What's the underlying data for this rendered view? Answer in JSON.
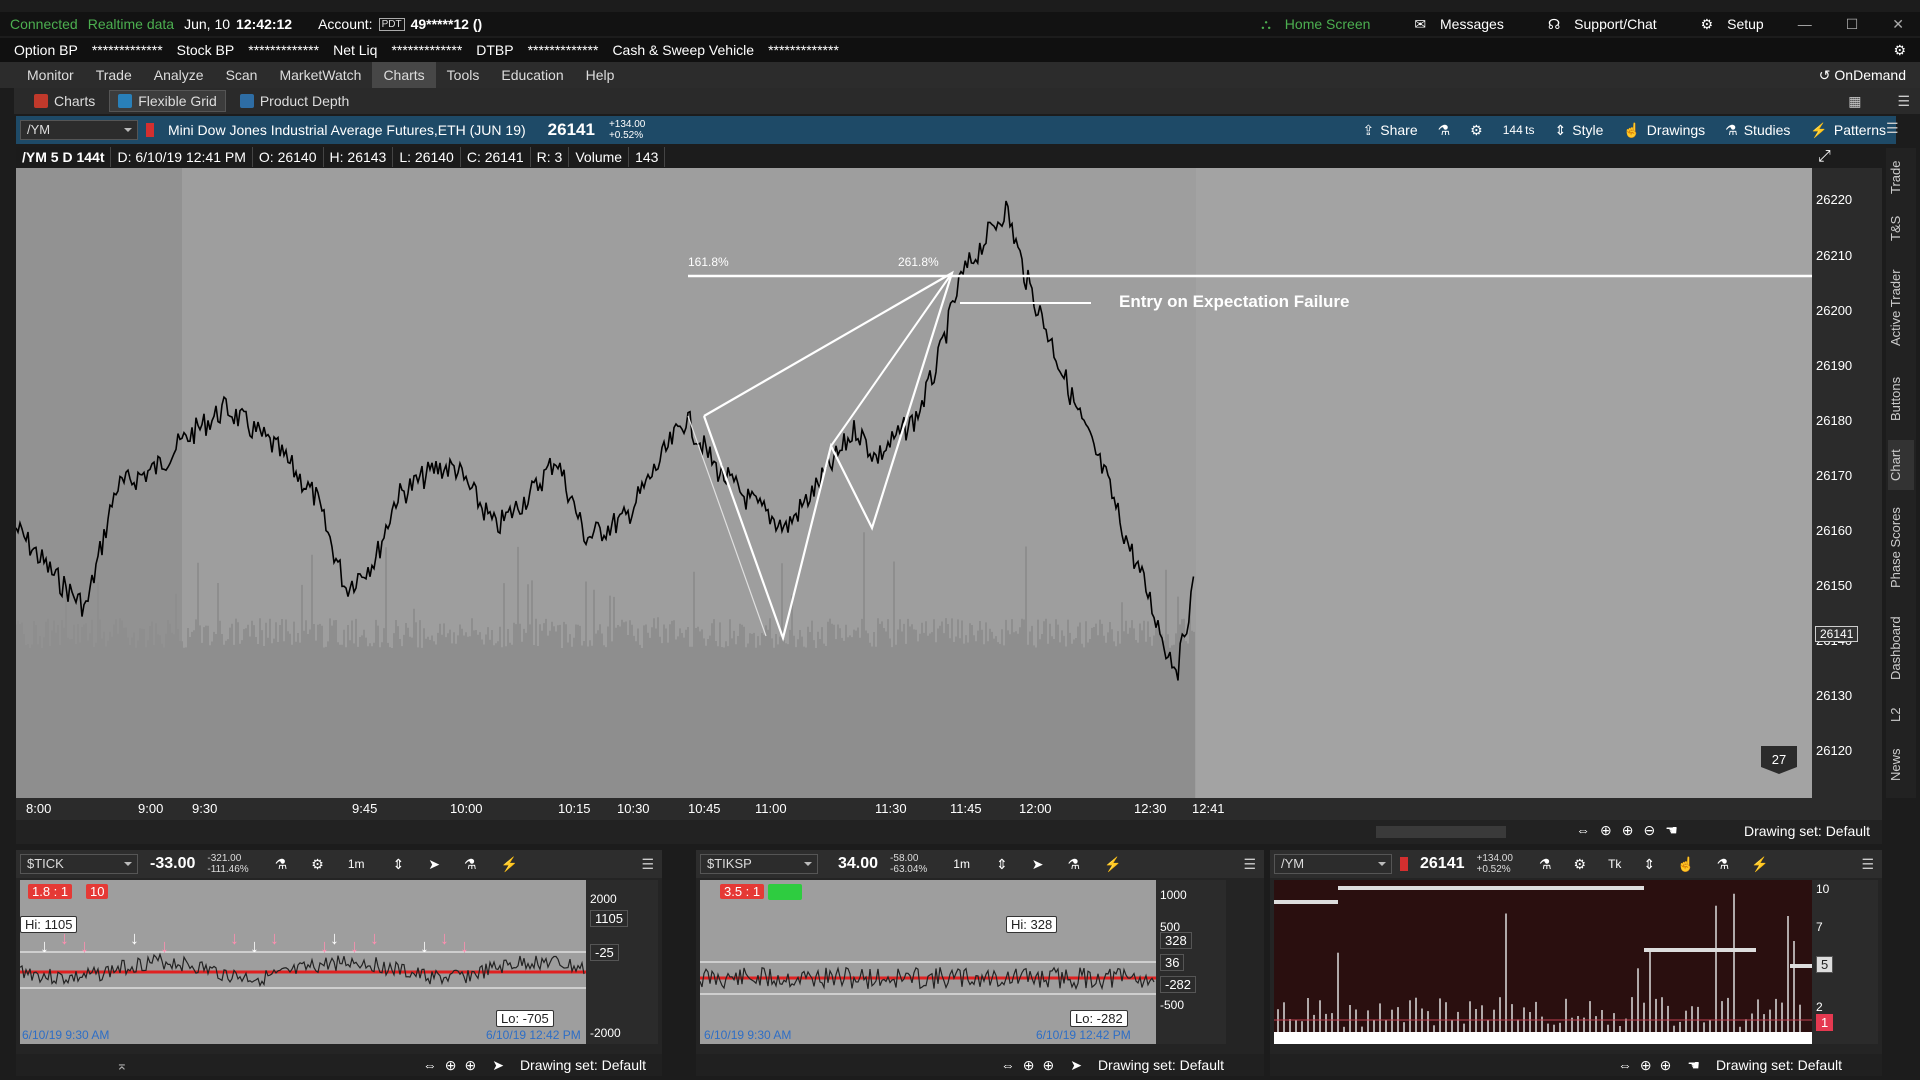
{
  "status": {
    "connected": "Connected",
    "realtime": "Realtime data",
    "date": "Jun, 10",
    "time": "12:42:12",
    "account_label": "Account:",
    "account_tag": "PDT",
    "account_value": "49*****12 ()",
    "home": "Home Screen",
    "messages": "Messages",
    "support": "Support/Chat",
    "setup": "Setup"
  },
  "balances": [
    {
      "label": "Option BP",
      "value": "*************"
    },
    {
      "label": "Stock BP",
      "value": "*************"
    },
    {
      "label": "Net Liq",
      "value": "*************"
    },
    {
      "label": "DTBP",
      "value": "*************"
    },
    {
      "label": "Cash & Sweep Vehicle",
      "value": "*************"
    }
  ],
  "nav": {
    "items": [
      "Monitor",
      "Trade",
      "Analyze",
      "Scan",
      "MarketWatch",
      "Charts",
      "Tools",
      "Education",
      "Help"
    ],
    "active": "Charts",
    "ondemand": "OnDemand"
  },
  "subnav": [
    "Charts",
    "Flexible Grid",
    "Product Depth"
  ],
  "chart_header": {
    "symbol": "/YM",
    "description": "Mini Dow Jones Industrial Average Futures,ETH (JUN 19)",
    "price": "26141",
    "change": "+134.00",
    "change_pct": "+0.52%",
    "share": "Share",
    "ticks": "144 ts",
    "style": "Style",
    "drawings": "Drawings",
    "studies": "Studies",
    "patterns": "Patterns"
  },
  "ohlc": {
    "sym": "/YM 5 D 144t",
    "date": "D: 6/10/19 12:41 PM",
    "open": "O: 26140",
    "high": "H: 26143",
    "low": "L: 26140",
    "close": "C: 26141",
    "range": "R: 3",
    "volume_label": "Volume",
    "volume": "143"
  },
  "main_chart": {
    "fib1": "161.8%",
    "fib2": "261.8%",
    "annotation": "Entry on Expectation Failure",
    "price_labels": [
      "26220",
      "26210",
      "26200",
      "26190",
      "26180",
      "26170",
      "26160",
      "26150",
      "26140",
      "26130",
      "26120"
    ],
    "current_price_tag": "26141",
    "time_labels": [
      "8:00",
      "9:00",
      "9:30",
      "9:45",
      "10:00",
      "10:15",
      "10:30",
      "10:45",
      "11:00",
      "11:30",
      "11:45",
      "12:00",
      "12:30",
      "12:41"
    ],
    "badge": "27",
    "drawing_set": "Drawing set: Default"
  },
  "side_tabs": [
    "Trade",
    "T&S",
    "Active Trader",
    "Buttons",
    "Chart",
    "Phase Scores",
    "Dashboard",
    "L2",
    "News"
  ],
  "panels": [
    {
      "symbol": "$TICK",
      "value": "-33.00",
      "chg1": "-321.00",
      "chg2": "-111.46%",
      "interval": "1m",
      "ratio": "1.8 : 1",
      "ratio_b": "10",
      "hi": "Hi: 1105",
      "lo": "Lo: -705",
      "scale": [
        "2000",
        "1105",
        "-25",
        "-2000"
      ],
      "start": "6/10/19 9:30 AM",
      "end": "6/10/19 12:42 PM",
      "drawing_set": "Drawing set: Default"
    },
    {
      "symbol": "$TIKSP",
      "value": "34.00",
      "chg1": "-58.00",
      "chg2": "-63.04%",
      "interval": "1m",
      "ratio": "3.5 : 1",
      "hi": "Hi: 328",
      "lo": "Lo: -282",
      "scale": [
        "1000",
        "500",
        "328",
        "36",
        "-282",
        "-500"
      ],
      "start": "6/10/19 9:30 AM",
      "end": "6/10/19 12:42 PM",
      "drawing_set": "Drawing set: Default"
    },
    {
      "symbol": "/YM",
      "value": "26141",
      "chg1": "+134.00",
      "chg2": "+0.52%",
      "interval": "Tk",
      "scale": [
        "10",
        "7",
        "5",
        "2",
        "1"
      ],
      "drawing_set": "Drawing set: Default"
    }
  ]
}
